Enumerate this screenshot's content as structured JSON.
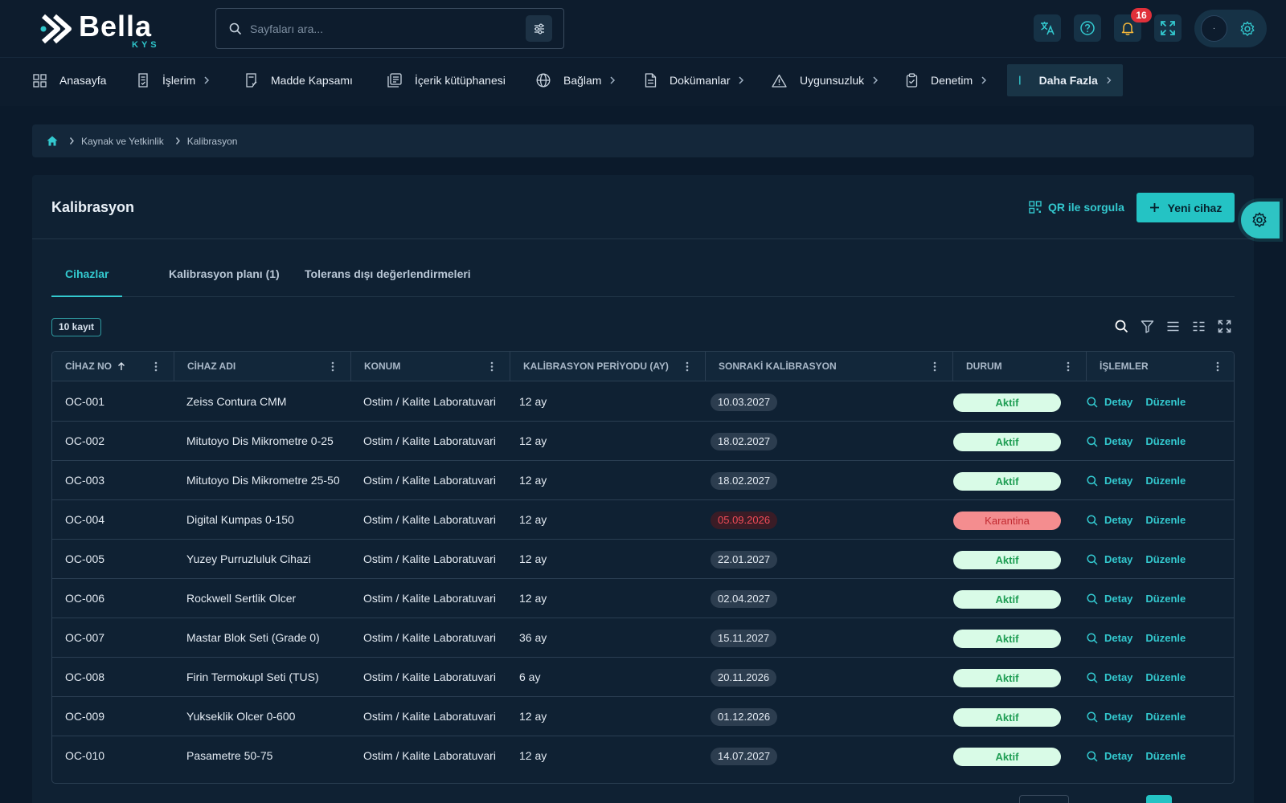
{
  "app": {
    "logo_name": "Bella",
    "logo_sub": "KYS",
    "search_placeholder": "Sayfaları ara...",
    "notification_count": "16",
    "avatar_text": "·"
  },
  "nav": {
    "items": [
      {
        "label": "Anasayfa",
        "icon": "grid-icon",
        "has_chevron": false
      },
      {
        "label": "İşlerim",
        "icon": "task-list-icon",
        "has_chevron": true
      },
      {
        "label": "Madde Kapsamı",
        "icon": "checklist-icon",
        "has_chevron": false
      },
      {
        "label": "İçerik kütüphanesi",
        "icon": "library-icon",
        "has_chevron": false
      },
      {
        "label": "Bağlam",
        "icon": "globe-icon",
        "has_chevron": true
      },
      {
        "label": "Dokümanlar",
        "icon": "document-icon",
        "has_chevron": true
      },
      {
        "label": "Uygunsuzluk",
        "icon": "warning-icon",
        "has_chevron": true
      },
      {
        "label": "Denetim",
        "icon": "clipboard-check-icon",
        "has_chevron": true
      },
      {
        "label": "Daha Fazla",
        "icon": "bar-icon",
        "has_chevron": true
      }
    ]
  },
  "breadcrumb": {
    "items": [
      "Kaynak ve Yetkinlik",
      "Kalibrasyon"
    ]
  },
  "page": {
    "title": "Kalibrasyon",
    "qr_label": "QR ile sorgula",
    "new_label": "Yeni cihaz",
    "record_count": "10 kayıt"
  },
  "tabs": [
    {
      "label": "Cihazlar",
      "active": true
    },
    {
      "label": "Kalibrasyon planı (1)",
      "active": false
    },
    {
      "label": "Tolerans dışı değerlendirmeleri",
      "active": false
    }
  ],
  "table": {
    "columns": [
      "CİHAZ NO",
      "CİHAZ ADI",
      "KONUM",
      "KALİBRASYON PERİYODU (AY)",
      "SONRAKİ KALİBRASYON",
      "DURUM",
      "İŞLEMLER"
    ],
    "detail_label": "Detay",
    "edit_label": "Düzenle",
    "rows": [
      {
        "no": "OC-001",
        "name": "Zeiss Contura CMM",
        "location": "Ostim / Kalite Laboratuvari",
        "period": "12 ay",
        "next": "10.03.2027",
        "status": "Aktif",
        "overdue": false
      },
      {
        "no": "OC-002",
        "name": "Mitutoyo Dis Mikrometre 0-25",
        "location": "Ostim / Kalite Laboratuvari",
        "period": "12 ay",
        "next": "18.02.2027",
        "status": "Aktif",
        "overdue": false
      },
      {
        "no": "OC-003",
        "name": "Mitutoyo Dis Mikrometre 25-50",
        "location": "Ostim / Kalite Laboratuvari",
        "period": "12 ay",
        "next": "18.02.2027",
        "status": "Aktif",
        "overdue": false
      },
      {
        "no": "OC-004",
        "name": "Digital Kumpas 0-150",
        "location": "Ostim / Kalite Laboratuvari",
        "period": "12 ay",
        "next": "05.09.2026",
        "status": "Karantina",
        "overdue": true
      },
      {
        "no": "OC-005",
        "name": "Yuzey Purruzluluk Cihazi",
        "location": "Ostim / Kalite Laboratuvari",
        "period": "12 ay",
        "next": "22.01.2027",
        "status": "Aktif",
        "overdue": false
      },
      {
        "no": "OC-006",
        "name": "Rockwell Sertlik Olcer",
        "location": "Ostim / Kalite Laboratuvari",
        "period": "12 ay",
        "next": "02.04.2027",
        "status": "Aktif",
        "overdue": false
      },
      {
        "no": "OC-007",
        "name": "Mastar Blok Seti (Grade 0)",
        "location": "Ostim / Kalite Laboratuvari",
        "period": "36 ay",
        "next": "15.11.2027",
        "status": "Aktif",
        "overdue": false
      },
      {
        "no": "OC-008",
        "name": "Firin Termokupl Seti (TUS)",
        "location": "Ostim / Kalite Laboratuvari",
        "period": "6 ay",
        "next": "20.11.2026",
        "status": "Aktif",
        "overdue": false
      },
      {
        "no": "OC-009",
        "name": "Yukseklik Olcer 0-600",
        "location": "Ostim / Kalite Laboratuvari",
        "period": "12 ay",
        "next": "01.12.2026",
        "status": "Aktif",
        "overdue": false
      },
      {
        "no": "OC-010",
        "name": "Pasametre 50-75",
        "location": "Ostim / Kalite Laboratuvari",
        "period": "12 ay",
        "next": "14.07.2027",
        "status": "Aktif",
        "overdue": false
      }
    ]
  },
  "colors": {
    "accent": "#33c9cf",
    "background": "#0b1a2b",
    "status_ok_bg": "#d9fbe7",
    "status_bad_bg": "#f48d8f",
    "overdue_text": "#f24c58",
    "badge": "#e0303a"
  }
}
